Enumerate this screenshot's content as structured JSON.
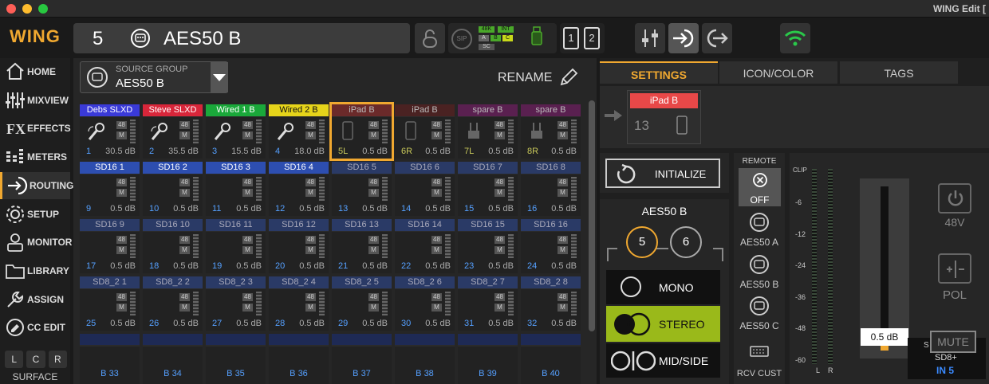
{
  "app": {
    "title": "WING Edit [",
    "logo": "WING"
  },
  "header": {
    "channel_number": "5",
    "channel_name": "AES50 B",
    "rate": "48K",
    "clock": "INT",
    "ab_a": "A",
    "ab_b": "B",
    "ab_c": "C",
    "sc": "SC",
    "sip": "SIP",
    "layer1": "1",
    "layer2": "2"
  },
  "sidebar": {
    "items": [
      {
        "label": "HOME",
        "icon": "home-icon"
      },
      {
        "label": "MIXVIEW",
        "icon": "mixview-icon"
      },
      {
        "label": "EFFECTS",
        "icon": "fx-icon"
      },
      {
        "label": "METERS",
        "icon": "meters-icon"
      },
      {
        "label": "ROUTING",
        "icon": "routing-icon",
        "active": true
      },
      {
        "label": "SETUP",
        "icon": "gear-icon"
      },
      {
        "label": "MONITOR",
        "icon": "monitor-icon"
      },
      {
        "label": "LIBRARY",
        "icon": "folder-icon"
      },
      {
        "label": "ASSIGN",
        "icon": "wrench-icon"
      },
      {
        "label": "CC EDIT",
        "icon": "cc-edit-icon"
      }
    ],
    "lcr": [
      "L",
      "C",
      "R"
    ],
    "surface": "SURFACE"
  },
  "source_group": {
    "caption": "SOURCE GROUP",
    "value": "AES50 B",
    "rename": "RENAME"
  },
  "tiles": {
    "row1": [
      {
        "name": "Debs SLXD",
        "color": "#3a3ad8",
        "num": "1",
        "gain": "30.5 dB",
        "icon": "wireless-mic"
      },
      {
        "name": "Steve SLXD",
        "color": "#d8263a",
        "num": "2",
        "gain": "35.5 dB",
        "icon": "wireless-mic"
      },
      {
        "name": "Wired 1 B",
        "color": "#1aa83a",
        "num": "3",
        "gain": "15.5 dB",
        "icon": "mic"
      },
      {
        "name": "Wired 2 B",
        "color": "#e6d41a",
        "num": "4",
        "gain": "18.0 dB",
        "icon": "mic"
      },
      {
        "name": "iPad B",
        "color": "#6b2a2a",
        "num": "5L",
        "gain": "0.5 dB",
        "icon": "tablet"
      },
      {
        "name": "iPad B",
        "color": "#4a2222",
        "num": "6R",
        "gain": "0.5 dB",
        "icon": "tablet"
      },
      {
        "name": "spare B",
        "color": "#5a2050",
        "num": "7L",
        "gain": "0.5 dB",
        "icon": "di"
      },
      {
        "name": "spare B",
        "color": "#5a2050",
        "num": "8R",
        "gain": "0.5 dB",
        "icon": "di"
      }
    ],
    "row2": [
      {
        "name": "SD16 1",
        "num": "9",
        "gain": "0.5 dB"
      },
      {
        "name": "SD16 2",
        "num": "10",
        "gain": "0.5 dB"
      },
      {
        "name": "SD16 3",
        "num": "11",
        "gain": "0.5 dB"
      },
      {
        "name": "SD16 4",
        "num": "12",
        "gain": "0.5 dB"
      },
      {
        "name": "SD16 5",
        "num": "13",
        "gain": "0.5 dB"
      },
      {
        "name": "SD16 6",
        "num": "14",
        "gain": "0.5 dB"
      },
      {
        "name": "SD16 7",
        "num": "15",
        "gain": "0.5 dB"
      },
      {
        "name": "SD16 8",
        "num": "16",
        "gain": "0.5 dB"
      }
    ],
    "row3": [
      {
        "name": "SD16 9",
        "num": "17",
        "gain": "0.5 dB"
      },
      {
        "name": "SD16 10",
        "num": "18",
        "gain": "0.5 dB"
      },
      {
        "name": "SD16 11",
        "num": "19",
        "gain": "0.5 dB"
      },
      {
        "name": "SD16 12",
        "num": "20",
        "gain": "0.5 dB"
      },
      {
        "name": "SD16 13",
        "num": "21",
        "gain": "0.5 dB"
      },
      {
        "name": "SD16 14",
        "num": "22",
        "gain": "0.5 dB"
      },
      {
        "name": "SD16 15",
        "num": "23",
        "gain": "0.5 dB"
      },
      {
        "name": "SD16 16",
        "num": "24",
        "gain": "0.5 dB"
      }
    ],
    "row4": [
      {
        "name": "SD8_2 1",
        "num": "25",
        "gain": "0.5 dB"
      },
      {
        "name": "SD8_2 2",
        "num": "26",
        "gain": "0.5 dB"
      },
      {
        "name": "SD8_2 3",
        "num": "27",
        "gain": "0.5 dB"
      },
      {
        "name": "SD8_2 4",
        "num": "28",
        "gain": "0.5 dB"
      },
      {
        "name": "SD8_2 5",
        "num": "29",
        "gain": "0.5 dB"
      },
      {
        "name": "SD8_2 6",
        "num": "30",
        "gain": "0.5 dB"
      },
      {
        "name": "SD8_2 7",
        "num": "31",
        "gain": "0.5 dB"
      },
      {
        "name": "SD8_2 8",
        "num": "32",
        "gain": "0.5 dB"
      }
    ],
    "row5": [
      "B 33",
      "B 34",
      "B 35",
      "B 36",
      "B 37",
      "B 38",
      "B 39",
      "B 40"
    ]
  },
  "right": {
    "tabs": [
      "SETTINGS",
      "ICON/COLOR",
      "TAGS"
    ],
    "preview": {
      "name": "iPad B",
      "number": "13"
    },
    "initialize": "INITIALIZE",
    "source_title": "AES50 B",
    "inputs": [
      "5",
      "6"
    ],
    "modes": [
      "MONO",
      "STEREO",
      "MID/SIDE"
    ],
    "remote": {
      "label": "REMOTE",
      "off": "OFF",
      "a": "AES50 A",
      "b": "AES50 B",
      "c": "AES50 C",
      "rcv": "RCV CUST"
    },
    "meter": {
      "clip": "CLIP",
      "scale": [
        "-6",
        "-12",
        "-24",
        "-36",
        "-48",
        "-60"
      ],
      "l": "L",
      "r": "R"
    },
    "fader_value": "0.5 dB",
    "phantom": "48V",
    "polarity": "POL",
    "mute": "MUTE",
    "device": "SD8+",
    "device_in": "IN 5",
    "device_partial": "S"
  },
  "colors": {
    "accent": "#f0a830",
    "sd_blue": "#2d4eb0",
    "sd_dim": "#2a3a66",
    "green": "#9ab91a"
  }
}
